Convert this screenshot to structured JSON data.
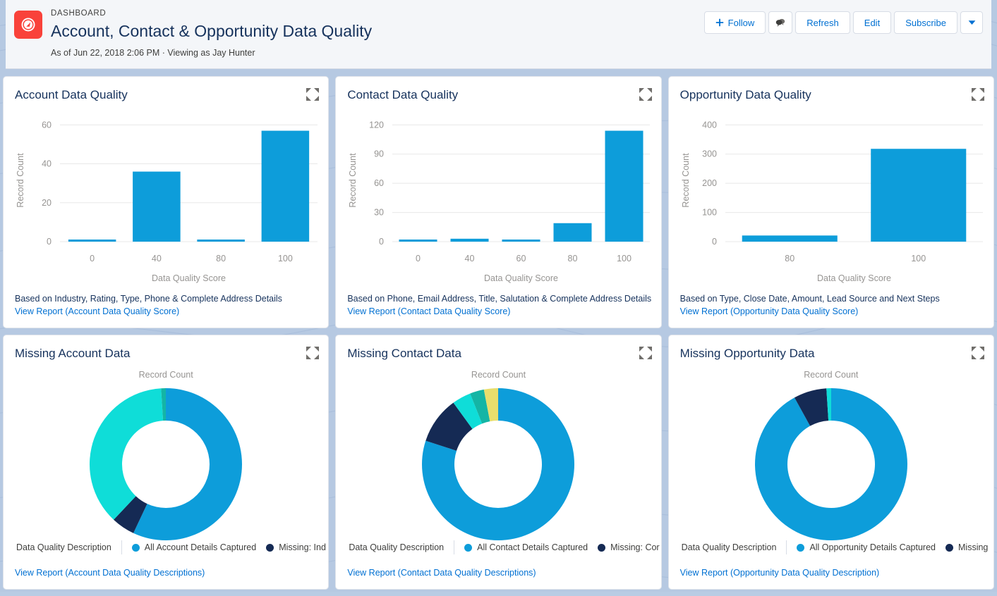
{
  "header": {
    "eyebrow": "DASHBOARD",
    "title": "Account, Contact & Opportunity Data Quality",
    "meta": "As of Jun 22, 2018 2:06 PM · Viewing as Jay Hunter",
    "logo_icon": "gauge-icon",
    "actions": {
      "follow": "Follow",
      "follow_icon": "plus-icon",
      "feed_icon": "chatter-feed-icon",
      "refresh": "Refresh",
      "edit": "Edit",
      "subscribe": "Subscribe",
      "more_icon": "chevron-down-icon"
    }
  },
  "colors": {
    "bar": "#0d9dda",
    "brand_red": "#f9423a",
    "link": "#0070d2",
    "title": "#16325c",
    "axis_gray": "#969492",
    "seg_blue": "#0d9dda",
    "seg_cyan": "#0fddd8",
    "seg_navy": "#152a54",
    "seg_teal": "#14b5a5",
    "seg_yellow": "#e8de6c"
  },
  "cards": {
    "account_quality": {
      "title": "Account Data Quality",
      "expand_icon": "expand-icon",
      "description": "Based on Industry, Rating, Type, Phone & Complete Address Details",
      "link": "View Report (Account Data Quality Score)"
    },
    "contact_quality": {
      "title": "Contact Data Quality",
      "expand_icon": "expand-icon",
      "description": "Based on Phone, Email Address, Title, Salutation & Complete Address Details",
      "link": "View Report (Contact Data Quality Score)"
    },
    "opportunity_quality": {
      "title": "Opportunity Data Quality",
      "expand_icon": "expand-icon",
      "description": "Based on Type, Close Date, Amount, Lead Source and Next Steps",
      "link": "View Report (Opportunity Data Quality Score)"
    },
    "missing_account": {
      "title": "Missing Account Data",
      "expand_icon": "expand-icon",
      "caption": "Record Count",
      "legend_axis": "Data Quality Description",
      "link": "View Report (Account Data Quality Descriptions)"
    },
    "missing_contact": {
      "title": "Missing Contact Data",
      "expand_icon": "expand-icon",
      "caption": "Record Count",
      "legend_axis": "Data Quality Description",
      "link": "View Report (Contact Data Quality Descriptions)"
    },
    "missing_opportunity": {
      "title": "Missing Opportunity Data",
      "expand_icon": "expand-icon",
      "caption": "Record Count",
      "legend_axis": "Data Quality Description",
      "link": "View Report (Opportunity Data Quality Description)"
    }
  },
  "chart_data": [
    {
      "id": "account_quality",
      "type": "bar",
      "title": "Account Data Quality",
      "xlabel": "Data Quality Score",
      "ylabel": "Record Count",
      "categories": [
        "0",
        "40",
        "80",
        "100"
      ],
      "values": [
        1,
        36,
        1,
        57
      ],
      "ylim": [
        0,
        63
      ],
      "yticks": [
        0,
        20,
        40,
        60
      ],
      "grid": true,
      "legend": "none",
      "color": "#0d9dda"
    },
    {
      "id": "contact_quality",
      "type": "bar",
      "title": "Contact Data Quality",
      "xlabel": "Data Quality Score",
      "ylabel": "Record Count",
      "categories": [
        "0",
        "40",
        "60",
        "80",
        "100"
      ],
      "values": [
        1,
        3,
        1,
        19,
        114
      ],
      "ylim": [
        0,
        126
      ],
      "yticks": [
        0,
        30,
        60,
        90,
        120
      ],
      "grid": true,
      "legend": "none",
      "color": "#0d9dda"
    },
    {
      "id": "opportunity_quality",
      "type": "bar",
      "title": "Opportunity Data Quality",
      "xlabel": "Data Quality Score",
      "ylabel": "Record Count",
      "categories": [
        "80",
        "100"
      ],
      "values": [
        21,
        318
      ],
      "ylim": [
        0,
        420
      ],
      "yticks": [
        0,
        100,
        200,
        300,
        400
      ],
      "grid": true,
      "legend": "none",
      "color": "#0d9dda"
    },
    {
      "id": "missing_account",
      "type": "pie",
      "title": "Missing Account Data",
      "caption": "Record Count",
      "legend_position": "bottom",
      "donut": true,
      "labels": [
        "All Account Details Captured",
        "Missing: Ind"
      ],
      "slices": [
        {
          "label": "All Account Details Captured",
          "value": 57,
          "color": "#0d9dda"
        },
        {
          "label": "Missing: Ind",
          "value": 5,
          "color": "#152a54"
        },
        {
          "label": "",
          "value": 37,
          "color": "#0fddd8"
        },
        {
          "label": "",
          "value": 1,
          "color": "#14b5a5"
        }
      ]
    },
    {
      "id": "missing_contact",
      "type": "pie",
      "title": "Missing Contact Data",
      "caption": "Record Count",
      "legend_position": "bottom",
      "donut": true,
      "labels": [
        "All Contact Details Captured",
        "Missing: Cor"
      ],
      "slices": [
        {
          "label": "All Contact Details Captured",
          "value": 80,
          "color": "#0d9dda"
        },
        {
          "label": "Missing: Cor",
          "value": 10,
          "color": "#152a54"
        },
        {
          "label": "",
          "value": 4,
          "color": "#0fddd8"
        },
        {
          "label": "",
          "value": 3,
          "color": "#14b5a5"
        },
        {
          "label": "",
          "value": 3,
          "color": "#e8de6c"
        }
      ]
    },
    {
      "id": "missing_opportunity",
      "type": "pie",
      "title": "Missing Opportunity Data",
      "caption": "Record Count",
      "legend_position": "bottom",
      "donut": true,
      "labels": [
        "All Opportunity Details Captured",
        "Missing"
      ],
      "slices": [
        {
          "label": "All Opportunity Details Captured",
          "value": 92,
          "color": "#0d9dda"
        },
        {
          "label": "Missing",
          "value": 7,
          "color": "#152a54"
        },
        {
          "label": "",
          "value": 1,
          "color": "#0fddd8"
        }
      ]
    }
  ]
}
